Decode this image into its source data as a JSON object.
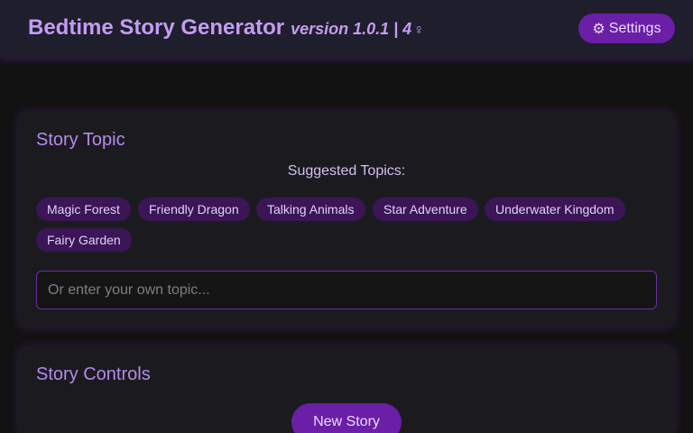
{
  "header": {
    "brand_glyph": "",
    "title": "Bedtime Story Generator",
    "version": "version 1.0.1 | 4",
    "emoji_suffix": "‍♀",
    "settings_icon": "⚙",
    "settings_label": "Settings",
    "accent_color": "#c49cf2",
    "button_color": "#6a1fa6"
  },
  "story_topic": {
    "heading": "Story Topic",
    "suggested_label": "Suggested Topics:",
    "topics": [
      "Magic Forest",
      "Friendly Dragon",
      "Talking Animals",
      "Star Adventure",
      "Underwater Kingdom",
      "Fairy Garden"
    ],
    "input": {
      "placeholder": "Or enter your own topic...",
      "value": ""
    }
  },
  "story_controls": {
    "heading": "Story Controls",
    "new_story_label": "New Story"
  }
}
